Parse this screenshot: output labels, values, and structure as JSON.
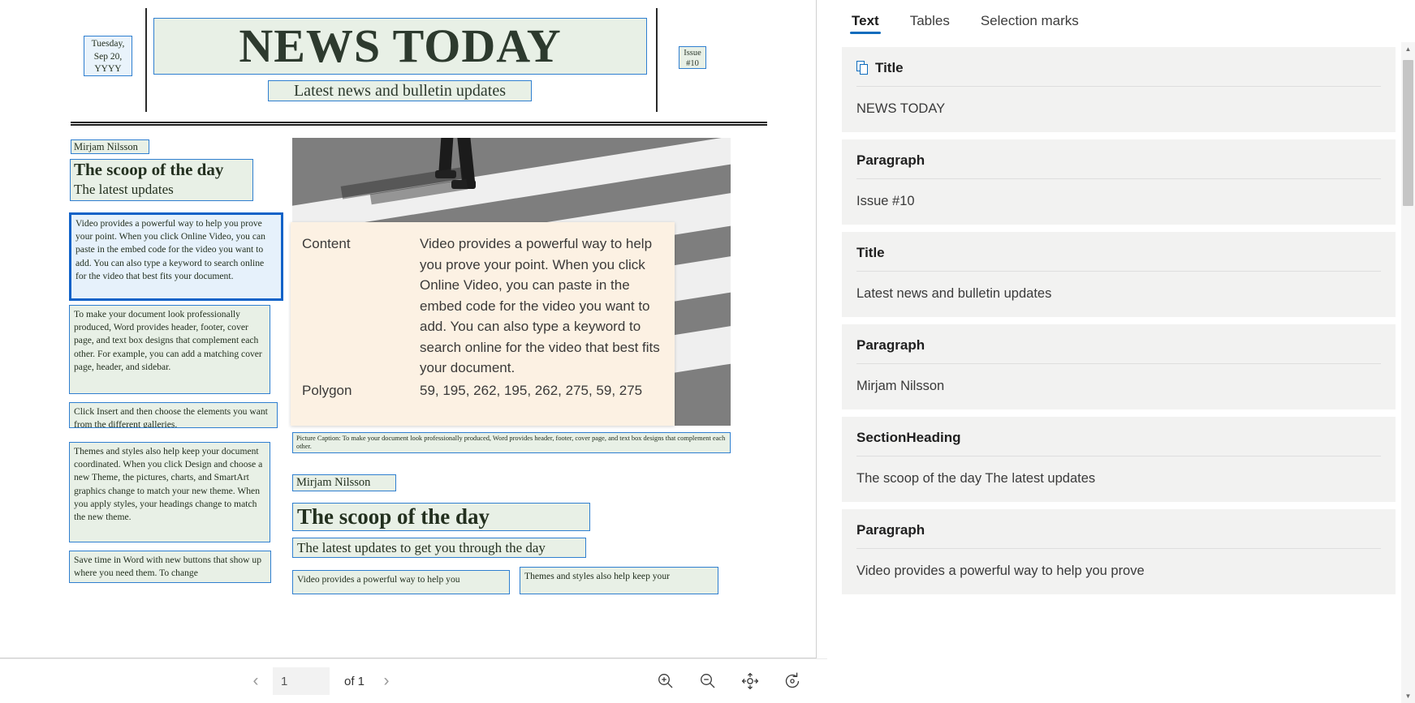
{
  "document": {
    "masthead": {
      "date": "Tuesday, Sep 20, YYYY",
      "date_line1": "Tuesday,",
      "date_line2": "Sep 20,",
      "date_line3": "YYYY",
      "title": "NEWS TODAY",
      "subtitle": "Latest news and bulletin updates",
      "issue": "Issue #10"
    },
    "left_column": {
      "byline": "Mirjam Nilsson",
      "heading": "The scoop of the day",
      "subheading": "The latest updates",
      "paragraph_1": "Video provides a powerful way to help you prove your point. When you click Online Video, you can paste in the embed code for the video you want to add. You can also type a keyword to search online for the video that best fits your document.",
      "paragraph_2": "To make your document look professionally produced, Word provides header, footer, cover page, and text box designs that complement each other. For example, you can add a matching cover page, header, and sidebar.",
      "paragraph_3": "Click Insert and then choose the elements you want from the different galleries.",
      "paragraph_4": "Themes and styles also help keep your document coordinated. When you click Design and choose a new Theme, the pictures, charts, and SmartArt graphics change to match your new theme. When you apply styles, your headings change to match the new theme.",
      "paragraph_5": "Save time in Word with new buttons that show up where you need them. To change"
    },
    "right_column": {
      "picture_caption": "Picture Caption: To make your document look professionally produced, Word provides header, footer, cover page, and text box designs that complement each other.",
      "byline": "Mirjam Nilsson",
      "heading": "The scoop of the day",
      "subheading": "The latest updates to get you through the day",
      "lower_left": "Video provides a powerful way to help you",
      "lower_right": "Themes and styles also help keep your"
    }
  },
  "tooltip": {
    "content_label": "Content",
    "content_value": "Video provides a powerful way to help you prove your point. When you click Online Video, you can paste in the embed code for the video you want to add. You can also type a keyword to search online for the video that best fits your document.",
    "polygon_label": "Polygon",
    "polygon_value": "59, 195, 262, 195, 262, 275, 59, 275"
  },
  "toolbar": {
    "prev_label": "‹",
    "next_label": "›",
    "page_value": "1",
    "page_placeholder": "1",
    "of_label": "of 1",
    "zoom_in": "zoom-in",
    "zoom_out": "zoom-out",
    "fit_page": "fit-to-page",
    "rotate": "rotate"
  },
  "panel": {
    "tabs": [
      {
        "label": "Text",
        "active": true
      },
      {
        "label": "Tables",
        "active": false
      },
      {
        "label": "Selection marks",
        "active": false
      }
    ],
    "cards": [
      {
        "type": "Title",
        "value": "NEWS TODAY",
        "icon": "document-copy-icon"
      },
      {
        "type": "Paragraph",
        "value": "Issue #10",
        "icon": ""
      },
      {
        "type": "Title",
        "value": "Latest news and bulletin updates",
        "icon": ""
      },
      {
        "type": "Paragraph",
        "value": "Mirjam Nilsson",
        "icon": ""
      },
      {
        "type": "SectionHeading",
        "value": "The scoop of the day The latest updates",
        "icon": ""
      },
      {
        "type": "Paragraph",
        "value": "Video provides a powerful way to help you prove",
        "icon": ""
      }
    ]
  },
  "colors": {
    "accent": "#0f6cbd",
    "selection_border": "#0f62c8",
    "highlight_box": "#e8f0e6",
    "tooltip_bg": "#fcf1e3",
    "card_bg": "#f2f2f1"
  }
}
